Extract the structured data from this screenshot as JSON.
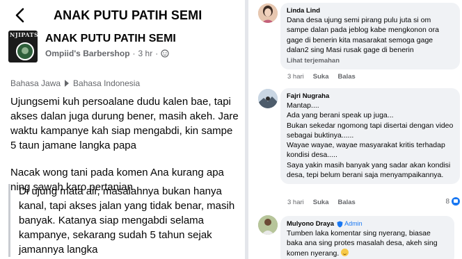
{
  "header": {
    "title": "ANAK PUTU PATIH SEMI"
  },
  "post": {
    "group_name": "ANAK PUTU PATIH SEMI",
    "avatar_text": "NJIPATSE",
    "author": "Ompiid's Barbershop",
    "time": "3 hr",
    "separator": "·",
    "translate_from": "Bahasa Jawa",
    "translate_to": "Bahasa Indonesia",
    "paragraphs": [
      "Ujungsemi kuh persoalane dudu kalen bae, tapi akses dalan juga durung bener, masih akeh. Jare waktu kampanye kah siap mengabdi, kin sampe 5 taun jamane langka papa",
      "Nacak wong tani pada komen Ana kurang apa ning sawah karo pertanian"
    ],
    "translation": "Di ujung mata air, masalahnya bukan hanya kanal, tapi akses jalan yang tidak benar, masih banyak. Katanya siap mengabdi selama kampanye, sekarang sudah 5 tahun sejak jamannya langka"
  },
  "comments": [
    {
      "name": "Linda Lind",
      "text": "Dana desa ujung semi pirang pulu  juta si om sampe dalan pada jeblog kabe mengkonon ora gage di benerin  kita masarakat semoga gage dalan2 sing Masi rusak gage di benerin",
      "see_translation": "Lihat terjemahan",
      "time": "3 hari",
      "like": "Suka",
      "reply": "Balas"
    },
    {
      "name": "Fajri Nugraha",
      "lines": [
        "Mantap....",
        "Ada yang berani speak up juga...",
        "Bukan sekedar ngomong tapi disertai dengan video sebagai buktinya......",
        "Wayae wayae, wayae masyarakat kritis terhadap kondisi desa.....",
        "Saya yakin masih banyak yang sadar akan kondisi desa, tepi belum berani saja menyampaikannya."
      ],
      "time": "3 hari",
      "like": "Suka",
      "reply": "Balas",
      "reaction_count": "8"
    },
    {
      "name": "Mulyono Draya",
      "badge": "Admin",
      "text": "Tumben laka komentar sing nyerang, biasae baka ana sing protes masalah desa, akeh sing komen nyerang."
    }
  ],
  "colors": {
    "accent": "#1877f2",
    "bubble": "#f0f2f5",
    "muted": "#65676b"
  }
}
